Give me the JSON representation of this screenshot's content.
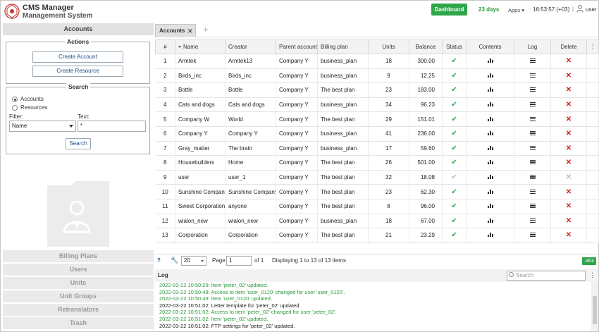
{
  "header": {
    "title": "CMS Manager",
    "subtitle": "Management System",
    "dashboard_label": "Dashboard",
    "days": "23 days",
    "apps_label": "Apps",
    "time": "16:53:57 (+03)",
    "separator": "|",
    "user": "user"
  },
  "left": {
    "panel_title": "Accounts",
    "actions_legend": "Actions",
    "create_account": "Create Account",
    "create_resource": "Create Resource",
    "search_legend": "Search",
    "radio_accounts": "Accounts",
    "radio_resources": "Resources",
    "filter_label": "Filter:",
    "text_label": "Text:",
    "filter_value": "Name",
    "text_value": "*",
    "search_button": "Search",
    "nav": [
      "Billing Plans",
      "Users",
      "Units",
      "Unit Groups",
      "Retranslators",
      "Trash"
    ]
  },
  "tabs": {
    "active": "Accounts",
    "close": "✕",
    "add": "+"
  },
  "table": {
    "headers": [
      "#",
      "Name",
      "Creator",
      "Parent account",
      "Billing plan",
      "Units",
      "Balance",
      "Status",
      "Contents",
      "Log",
      "Delete"
    ],
    "menu": "⋮",
    "rows": [
      {
        "n": "1",
        "name": "Armtek",
        "creator": "Armtek13",
        "parent": "Company Y",
        "plan": "business_plan",
        "units": "18",
        "balance": "300.00",
        "dim": false
      },
      {
        "n": "2",
        "name": "Birds_inc",
        "creator": "Birds_inc",
        "parent": "Company Y",
        "plan": "business_plan",
        "units": "9",
        "balance": "12.25",
        "dim": false
      },
      {
        "n": "3",
        "name": "Bottle",
        "creator": "Bottle",
        "parent": "Company Y",
        "plan": "The best plan",
        "units": "23",
        "balance": "183.00",
        "dim": false
      },
      {
        "n": "4",
        "name": "Cats and dogs",
        "creator": "Cats and dogs",
        "parent": "Company Y",
        "plan": "business_plan",
        "units": "34",
        "balance": "96.23",
        "dim": false
      },
      {
        "n": "5",
        "name": "Company W",
        "creator": "World",
        "parent": "Company Y",
        "plan": "The best plan",
        "units": "29",
        "balance": "151.01",
        "dim": false
      },
      {
        "n": "6",
        "name": "Company Y",
        "creator": "Company Y",
        "parent": "Company Y",
        "plan": "business_plan",
        "units": "41",
        "balance": "236.00",
        "dim": false
      },
      {
        "n": "7",
        "name": "Gray_matter",
        "creator": "The brain",
        "parent": "Company Y",
        "plan": "business_plan",
        "units": "17",
        "balance": "59.60",
        "dim": false
      },
      {
        "n": "8",
        "name": "Housebuilders",
        "creator": "Home",
        "parent": "Company Y",
        "plan": "The best plan",
        "units": "26",
        "balance": "501.00",
        "dim": false
      },
      {
        "n": "9",
        "name": "user",
        "creator": "user_1",
        "parent": "Company Y",
        "plan": "The best plan",
        "units": "32",
        "balance": "18.08",
        "dim": true
      },
      {
        "n": "10",
        "name": "Sunshine Company",
        "creator": "Sunshine Company",
        "parent": "Company Y",
        "plan": "The best plan",
        "units": "23",
        "balance": "62.30",
        "dim": false
      },
      {
        "n": "11",
        "name": "Sweet Corporation",
        "creator": "anyone",
        "parent": "Company Y",
        "plan": "The best plan",
        "units": "8",
        "balance": "96.00",
        "dim": false
      },
      {
        "n": "12",
        "name": "wialon_new",
        "creator": "wialon_new",
        "parent": "Company Y",
        "plan": "business_plan",
        "units": "18",
        "balance": "67.00",
        "dim": false
      },
      {
        "n": "13",
        "name": "Corporation",
        "creator": "Corporation",
        "parent": "Company Y",
        "plan": "The best plan",
        "units": "21",
        "balance": "23.29",
        "dim": false
      }
    ]
  },
  "pager": {
    "help": "?",
    "page_size": "20",
    "page_label": "Page",
    "page_value": "1",
    "of_label": "of 1",
    "displaying": "Displaying 1 to 13 of 13 items",
    "export": ".xlsx"
  },
  "log": {
    "title": "Log",
    "search_placeholder": "Search",
    "menu": "⋮",
    "lines": [
      {
        "text": "2022-03-22 10:50:29: Item 'peter_02' updated.",
        "green": true
      },
      {
        "text": "2022-03-22 10:50:49: Access to item 'user_0120' changed for user 'user_0120'.",
        "green": true
      },
      {
        "text": "2022-03-22 10:50:49: Item 'user_0120' updated.",
        "green": true
      },
      {
        "text": "2022-03-22 10:51:02: Letter template for 'peter_02' updated.",
        "green": false
      },
      {
        "text": "2022-03-22 10:51:02: Access to item 'peter_02' changed for user 'peter_02'.",
        "green": true
      },
      {
        "text": "2022-03-22 10:51:02: Item 'peter_02' updated.",
        "green": true
      },
      {
        "text": "2022-03-22 10:51:02: FTP settings for 'peter_02' updated.",
        "green": false
      }
    ]
  },
  "colors": {
    "accent_green": "#2ea64a",
    "delete_red": "#d42020",
    "link_blue": "#1c4f8a"
  }
}
